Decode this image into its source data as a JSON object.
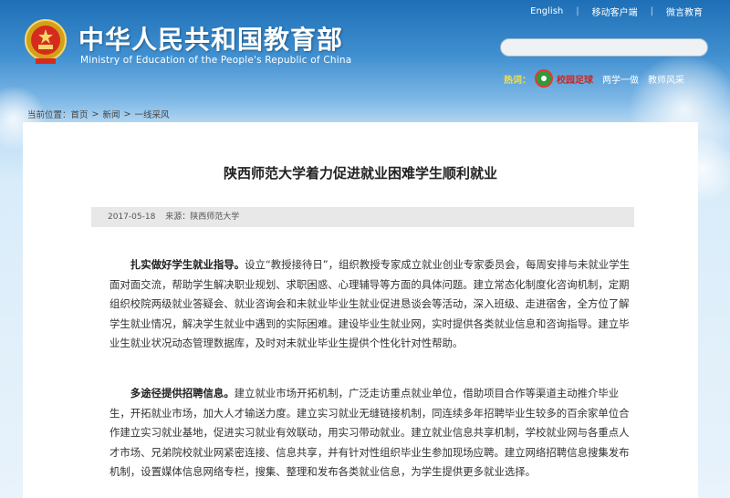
{
  "header": {
    "site_title": "中华人民共和国教育部",
    "site_subtitle": "Ministry of Education of the People's Republic of China",
    "top_links": [
      "English",
      "移动客户端",
      "微言教育"
    ],
    "hot_label": "热词：",
    "hot_links": [
      "校园足球",
      "两学一做",
      "教师风采"
    ]
  },
  "breadcrumb": {
    "prefix": "当前位置：",
    "items": [
      "首页",
      "新闻",
      "一线采风"
    ]
  },
  "article": {
    "title": "陕西师范大学着力促进就业困难学生顺利就业",
    "date": "2017-05-18",
    "source": "来源：陕西师范大学",
    "paragraphs": [
      {
        "lead": "扎实做好学生就业指导。",
        "body": "设立“教授接待日”，组织教授专家成立就业创业专家委员会，每周安排与未就业学生面对面交流，帮助学生解决职业规划、求职困惑、心理辅导等方面的具体问题。建立常态化制度化咨询机制，定期组织校院两级就业答疑会、就业咨询会和未就业毕业生就业促进恳谈会等活动，深入班级、走进宿舍，全方位了解学生就业情况，解决学生就业中遇到的实际困难。建设毕业生就业网，实时提供各类就业信息和咨询指导。建立毕业生就业状况动态管理数据库，及时对未就业毕业生提供个性化针对性帮助。"
      },
      {
        "lead": "多途径提供招聘信息。",
        "body": "建立就业市场开拓机制，广泛走访重点就业单位，借助项目合作等渠道主动推介毕业生，开拓就业市场，加大人才输送力度。建立实习就业无缝链接机制，同连续多年招聘毕业生较多的百余家单位合作建立实习就业基地，促进实习就业有效联动，用实习带动就业。建立就业信息共享机制，学校就业网与各重点人才市场、兄弟院校就业网紧密连接、信息共享，并有针对性组织毕业生参加现场应聘。建立网络招聘信息搜集发布机制，设置媒体信息网络专栏，搜集、整理和发布各类就业信息，为学生提供更多就业选择。"
      }
    ]
  },
  "colors": {
    "header_blue": "#1e6fb6",
    "hot_label": "#f2e24a",
    "hot_primary": "#d0261f"
  },
  "icons": [
    "national-emblem-icon",
    "football-badge-icon"
  ]
}
